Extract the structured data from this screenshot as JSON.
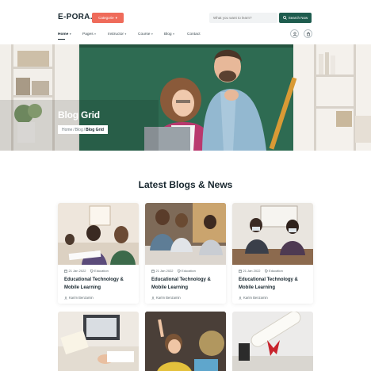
{
  "header": {
    "logo": "E-PORA.",
    "category_button": "Categorie",
    "search_placeholder": "What you want to learn?",
    "search_button": "Search Now",
    "nav": [
      "Home",
      "Pages",
      "Instructor",
      "Course",
      "Blog",
      "Contact"
    ]
  },
  "hero": {
    "title": "Blog Grid",
    "breadcrumb": {
      "home": "Home",
      "sep": " / ",
      "blog": "Blog",
      "current": "Blog Grid"
    }
  },
  "section": {
    "title": "Latest Blogs & News"
  },
  "cards": [
    {
      "date": "21 Jan 2022",
      "category": "Education",
      "title_line1": "Educational Technology &",
      "title_line2": "Mobile Learning",
      "author": "Karim Benzamin"
    },
    {
      "date": "21 Jan 2022",
      "category": "Education",
      "title_line1": "Educational Technology &",
      "title_line2": "Mobile Learning",
      "author": "Karim Benzamin"
    },
    {
      "date": "21 Jan 2022",
      "category": "Education",
      "title_line1": "Educational Technology &",
      "title_line2": "Mobile Learning",
      "author": "Karim Benzamin"
    }
  ],
  "colors": {
    "accent": "#ef6b5a",
    "primary": "#1e5c4e",
    "dark": "#17262e"
  },
  "icons": {
    "user": "user-icon",
    "cart": "cart-icon",
    "search": "search-icon",
    "calendar": "calendar-icon",
    "tag": "tag-icon",
    "author": "user-icon"
  }
}
